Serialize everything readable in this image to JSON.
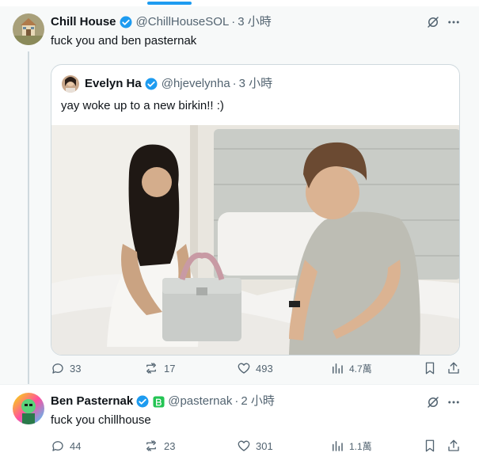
{
  "colors": {
    "accent": "#1d9bf0",
    "text": "#0f1419",
    "muted": "#536471",
    "border": "#cfd9de"
  },
  "post1": {
    "author": {
      "name": "Chill House",
      "handle": "@ChillHouseSOL",
      "time": "3 小時",
      "verified": true
    },
    "text": "fuck you and ben pasternak",
    "icons": [
      "grok-icon",
      "more-icon"
    ],
    "quote": {
      "author": {
        "name": "Evelyn Ha",
        "handle": "@hjevelynha",
        "time": "3 小時",
        "verified": true
      },
      "text": "yay woke up to a new birkin!! :)",
      "image": "photo"
    },
    "actions": {
      "replies": "33",
      "reposts": "17",
      "likes": "493",
      "views": "4.7萬"
    }
  },
  "post2": {
    "author": {
      "name": "Ben Pasternak",
      "handle": "@pasternak",
      "time": "2 小時",
      "verified": true,
      "affiliate_badge": "green-badge"
    },
    "text": "fuck you chillhouse",
    "icons": [
      "grok-icon",
      "more-icon"
    ],
    "actions": {
      "replies": "44",
      "reposts": "23",
      "likes": "301",
      "views": "1.1萬"
    }
  }
}
